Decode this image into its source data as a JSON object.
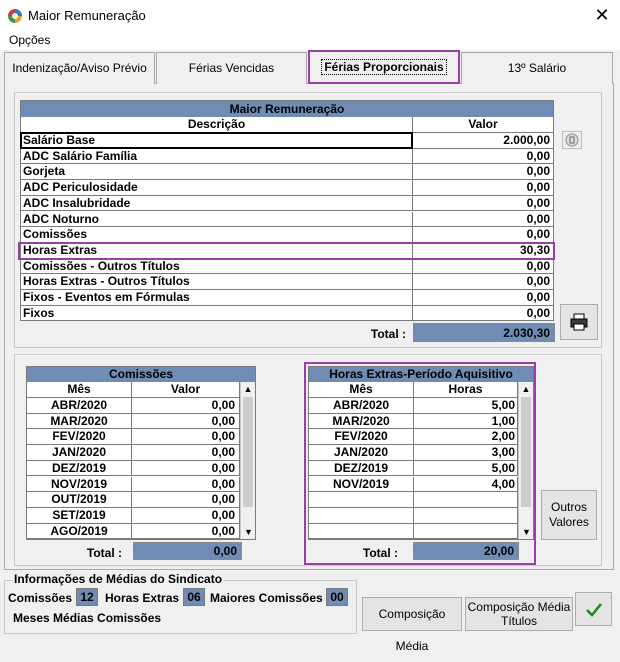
{
  "window": {
    "title": "Maior Remuneração",
    "close": "✕"
  },
  "menu": {
    "opcoes": "Opções"
  },
  "tabs": [
    "Indenização/Aviso Prévio",
    "Férias Vencidas",
    "Férias Proporcionais",
    "13º Salário"
  ],
  "maior": {
    "title": "Maior Remuneração",
    "col_desc": "Descrição",
    "col_valor": "Valor",
    "rows": [
      {
        "desc": "Salário Base",
        "valor": "2.000,00"
      },
      {
        "desc": "ADC Salário Família",
        "valor": "0,00"
      },
      {
        "desc": "Gorjeta",
        "valor": "0,00"
      },
      {
        "desc": "ADC Periculosidade",
        "valor": "0,00"
      },
      {
        "desc": "ADC Insalubridade",
        "valor": "0,00"
      },
      {
        "desc": "ADC Noturno",
        "valor": "0,00"
      },
      {
        "desc": "Comissões",
        "valor": "0,00"
      },
      {
        "desc": "Horas Extras",
        "valor": "30,30"
      },
      {
        "desc": "Comissões - Outros Títulos",
        "valor": "0,00"
      },
      {
        "desc": "Horas Extras - Outros Títulos",
        "valor": "0,00"
      },
      {
        "desc": "Fixos - Eventos em Fórmulas",
        "valor": "0,00"
      },
      {
        "desc": "Fixos",
        "valor": "0,00"
      }
    ],
    "total_label": "Total :",
    "total_value": "2.030,30"
  },
  "comissoes": {
    "title": "Comissões",
    "col_mes": "Mês",
    "col_valor": "Valor",
    "rows": [
      {
        "mes": "ABR/2020",
        "valor": "0,00"
      },
      {
        "mes": "MAR/2020",
        "valor": "0,00"
      },
      {
        "mes": "FEV/2020",
        "valor": "0,00"
      },
      {
        "mes": "JAN/2020",
        "valor": "0,00"
      },
      {
        "mes": "DEZ/2019",
        "valor": "0,00"
      },
      {
        "mes": "NOV/2019",
        "valor": "0,00"
      },
      {
        "mes": "OUT/2019",
        "valor": "0,00"
      },
      {
        "mes": "SET/2019",
        "valor": "0,00"
      },
      {
        "mes": "AGO/2019",
        "valor": "0,00"
      }
    ],
    "total_label": "Total :",
    "total_value": "0,00"
  },
  "horas": {
    "title": "Horas Extras-Período Aquisitivo",
    "col_mes": "Mês",
    "col_horas": "Horas",
    "rows": [
      {
        "mes": "ABR/2020",
        "horas": "5,00"
      },
      {
        "mes": "MAR/2020",
        "horas": "1,00"
      },
      {
        "mes": "FEV/2020",
        "horas": "2,00"
      },
      {
        "mes": "JAN/2020",
        "horas": "3,00"
      },
      {
        "mes": "DEZ/2019",
        "horas": "5,00"
      },
      {
        "mes": "NOV/2019",
        "horas": "4,00"
      },
      {
        "mes": "",
        "horas": ""
      },
      {
        "mes": "",
        "horas": ""
      },
      {
        "mes": "",
        "horas": ""
      }
    ],
    "total_label": "Total :",
    "total_value": "20,00"
  },
  "buttons": {
    "outros_valores": "Outros Valores",
    "composicao_media": "Composição Média",
    "composicao_media_titulos": "Composição Média Títulos"
  },
  "sindicato": {
    "title": "Informações de Médias do Sindicato",
    "comissoes_label": "Comissões",
    "comissoes_value": "12",
    "horas_label": "Horas Extras",
    "horas_value": "06",
    "maiores_label": "Maiores Comissões",
    "maiores_value": "00",
    "meses_label": "Meses Médias Comissões"
  },
  "icons": [
    "calculator-icon",
    "printer-icon",
    "check-icon",
    "scroll-up-icon",
    "scroll-down-icon"
  ],
  "colors": {
    "header_blue": "#6f8db4",
    "highlight_purple": "#9a3fa8",
    "ok_green": "#1a8a1a"
  }
}
